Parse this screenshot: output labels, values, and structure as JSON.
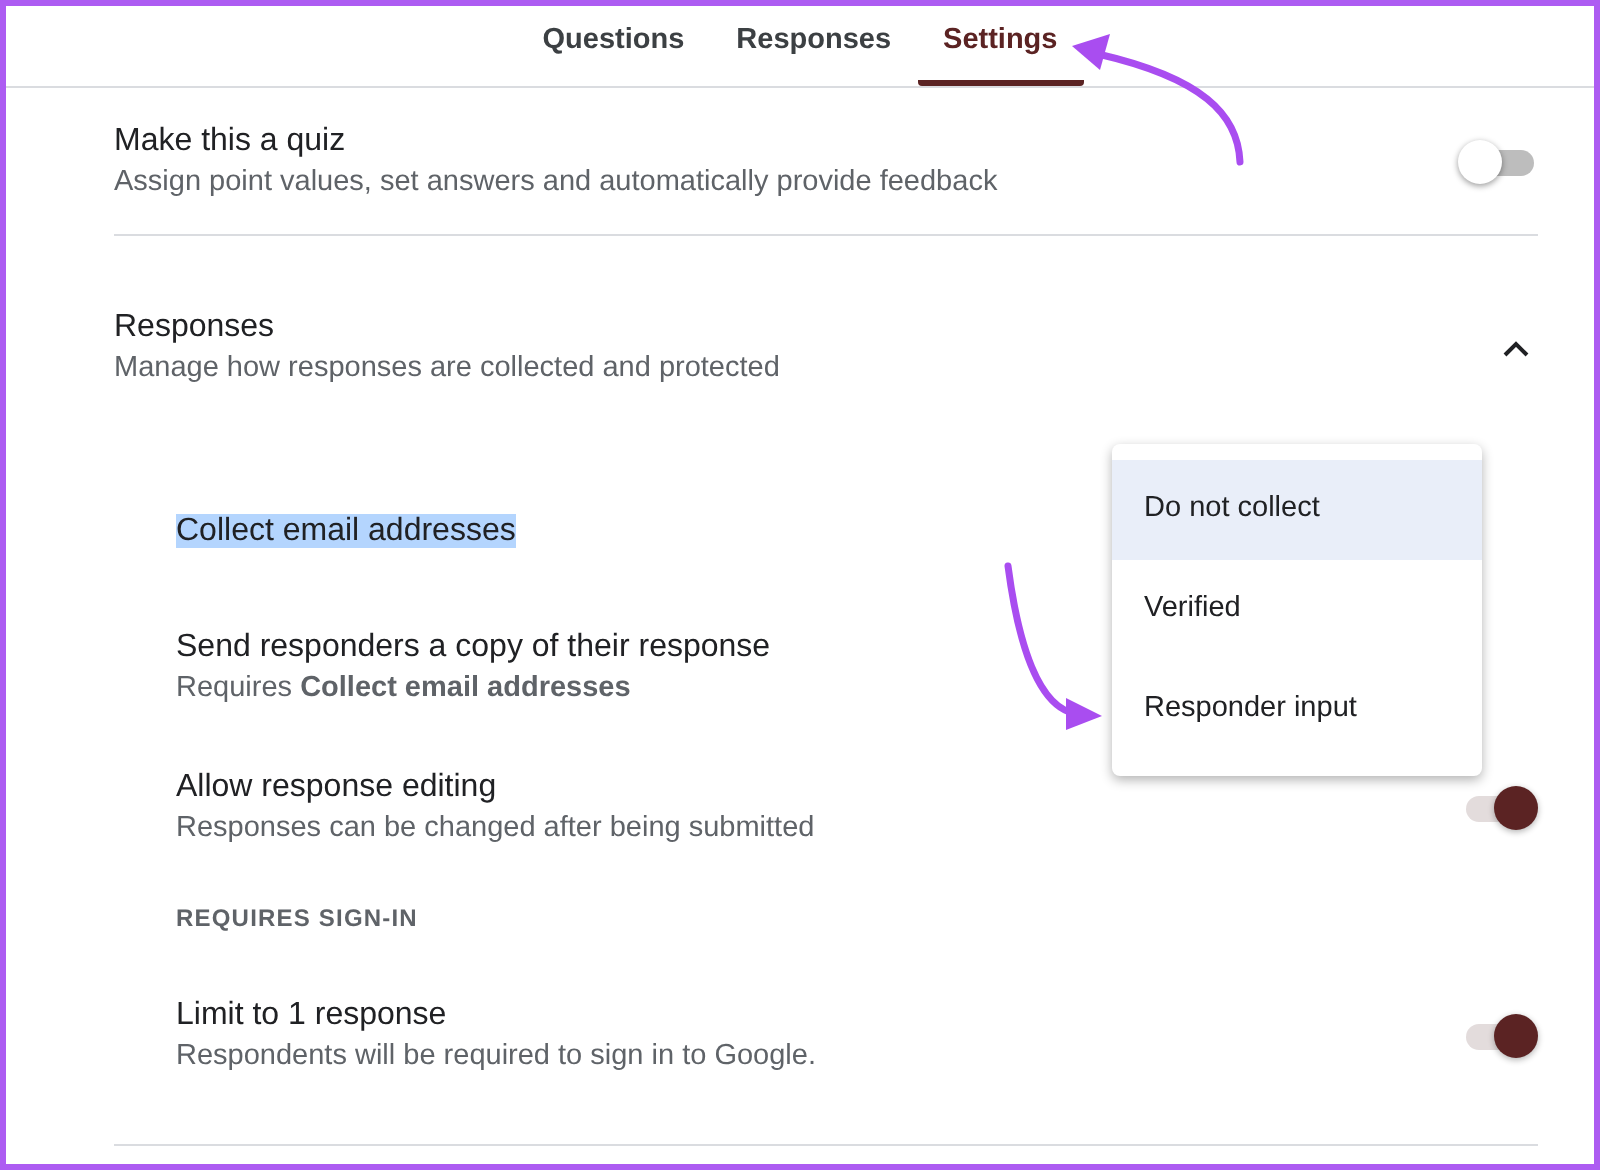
{
  "tabs": [
    {
      "label": "Questions",
      "selected": false
    },
    {
      "label": "Responses",
      "selected": false
    },
    {
      "label": "Settings",
      "selected": true
    }
  ],
  "quiz": {
    "title": "Make this a quiz",
    "description": "Assign point values, set answers and automatically provide feedback",
    "on": false
  },
  "responses_section": {
    "title": "Responses",
    "description": "Manage how responses are collected and protected",
    "expanded": true,
    "settings": [
      {
        "kind": "dropdown",
        "title": "Collect email addresses",
        "highlighted": true
      },
      {
        "kind": "plain",
        "title": "Send responders a copy of their response",
        "description": "Requires **Collect email addresses**"
      },
      {
        "kind": "toggle",
        "title": "Allow response editing",
        "description": "Responses can be changed after being submitted",
        "on": true
      },
      {
        "kind": "heading",
        "title": "REQUIRES SIGN-IN"
      },
      {
        "kind": "toggle",
        "title": "Limit to 1 response",
        "description": "Respondents will be required to sign in to Google.",
        "on": true
      }
    ]
  },
  "dropdown_menu": {
    "options": [
      {
        "label": "Do not collect",
        "selected": true
      },
      {
        "label": "Verified",
        "selected": false
      },
      {
        "label": "Responder input",
        "selected": false
      }
    ]
  }
}
